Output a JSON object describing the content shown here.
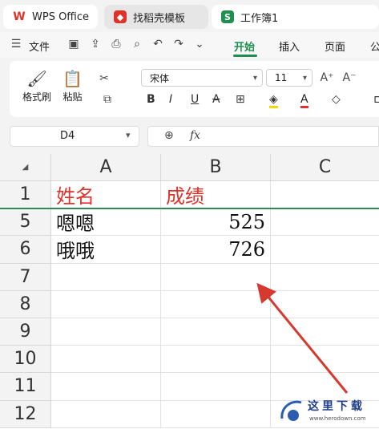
{
  "tabs": [
    {
      "label": "WPS Office",
      "icon": "wps-logo-icon"
    },
    {
      "label": "找稻壳模板",
      "icon": "docer-icon"
    },
    {
      "label": "工作簿1",
      "icon": "sheet-icon"
    }
  ],
  "menu": {
    "file": "文件",
    "start": "开始",
    "insert": "插入",
    "layout": "页面",
    "formula": "公"
  },
  "ribbon": {
    "format_painter": "格式刷",
    "paste": "粘贴",
    "font_name": "宋体",
    "font_size": "11"
  },
  "namebox": {
    "value": "D4"
  },
  "formula_bar": {
    "fx": "fx",
    "value": ""
  },
  "columns": [
    "A",
    "B",
    "C"
  ],
  "rows": [
    {
      "num": "1",
      "a": "姓名",
      "b": "成绩"
    },
    {
      "num": "5",
      "a": "嗯嗯",
      "b": "525"
    },
    {
      "num": "6",
      "a": "哦哦",
      "b": "726"
    },
    {
      "num": "7",
      "a": "",
      "b": ""
    },
    {
      "num": "8",
      "a": "",
      "b": ""
    },
    {
      "num": "9",
      "a": "",
      "b": ""
    },
    {
      "num": "10",
      "a": "",
      "b": ""
    },
    {
      "num": "11",
      "a": "",
      "b": ""
    },
    {
      "num": "12",
      "a": "",
      "b": ""
    }
  ],
  "watermark": {
    "title": "这里下载",
    "url": "www.herodown.com"
  },
  "colors": {
    "accent": "#1e8f4e",
    "header_text": "#e0322b",
    "arrow": "#d63a2f"
  }
}
